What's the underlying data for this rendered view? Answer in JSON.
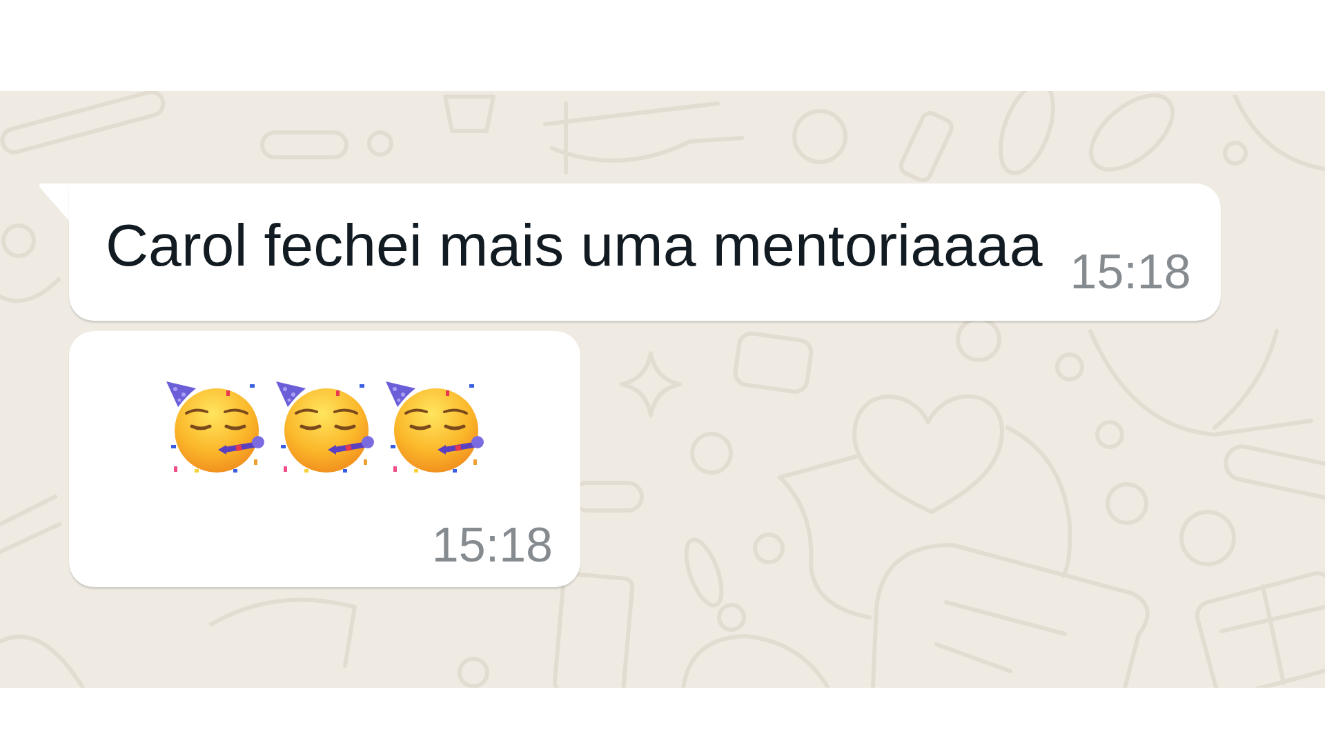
{
  "chat": {
    "messages": [
      {
        "kind": "text",
        "tail": true,
        "text": "Carol fechei mais uma mentoriaaaa",
        "time": "15:18"
      },
      {
        "kind": "emoji",
        "tail": false,
        "emojis": [
          {
            "kind": "party-face"
          },
          {
            "kind": "party-face"
          },
          {
            "kind": "party-face"
          }
        ],
        "time": "15:18"
      }
    ]
  }
}
